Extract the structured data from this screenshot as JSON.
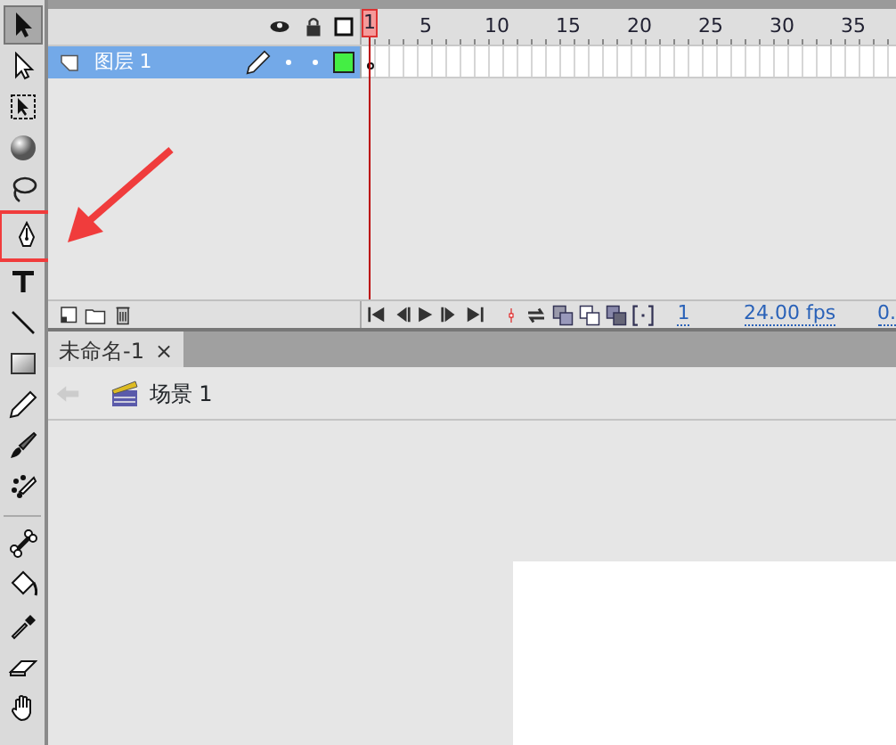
{
  "tools": [
    {
      "kind": "selection",
      "selected": true,
      "annotated": false
    },
    {
      "kind": "subselection",
      "selected": false,
      "annotated": false
    },
    {
      "kind": "transform",
      "selected": false,
      "annotated": false
    },
    {
      "kind": "rotate3d",
      "selected": false,
      "annotated": false
    },
    {
      "kind": "lasso",
      "selected": false,
      "annotated": false
    },
    {
      "kind": "pen",
      "selected": false,
      "annotated": true
    },
    {
      "kind": "text",
      "selected": false,
      "annotated": false
    },
    {
      "kind": "line",
      "selected": false,
      "annotated": false
    },
    {
      "kind": "rect",
      "selected": false,
      "annotated": false
    },
    {
      "kind": "pencil",
      "selected": false,
      "annotated": false
    },
    {
      "kind": "brush",
      "selected": false,
      "annotated": false
    },
    {
      "kind": "deco",
      "selected": false,
      "annotated": false
    },
    {
      "kind": "bone",
      "selected": false,
      "annotated": false
    },
    {
      "kind": "bucket",
      "selected": false,
      "annotated": false
    },
    {
      "kind": "eyedropper",
      "selected": false,
      "annotated": false
    },
    {
      "kind": "eraser",
      "selected": false,
      "annotated": false
    },
    {
      "kind": "hand",
      "selected": false,
      "annotated": false
    }
  ],
  "timeline": {
    "frame_numbers": [
      "1",
      "5",
      "10",
      "15",
      "20",
      "25",
      "30",
      "35"
    ],
    "layers": [
      {
        "name": "图层 1",
        "selected": true,
        "color": "#44ee44"
      }
    ],
    "status": {
      "current_frame": "1",
      "frame_rate": "24.00 fps",
      "elapsed": "0."
    }
  },
  "document_tabs": [
    {
      "title": "未命名-1",
      "close": "×",
      "selected": true
    }
  ],
  "breadcrumb": {
    "scene": "场景 1"
  }
}
